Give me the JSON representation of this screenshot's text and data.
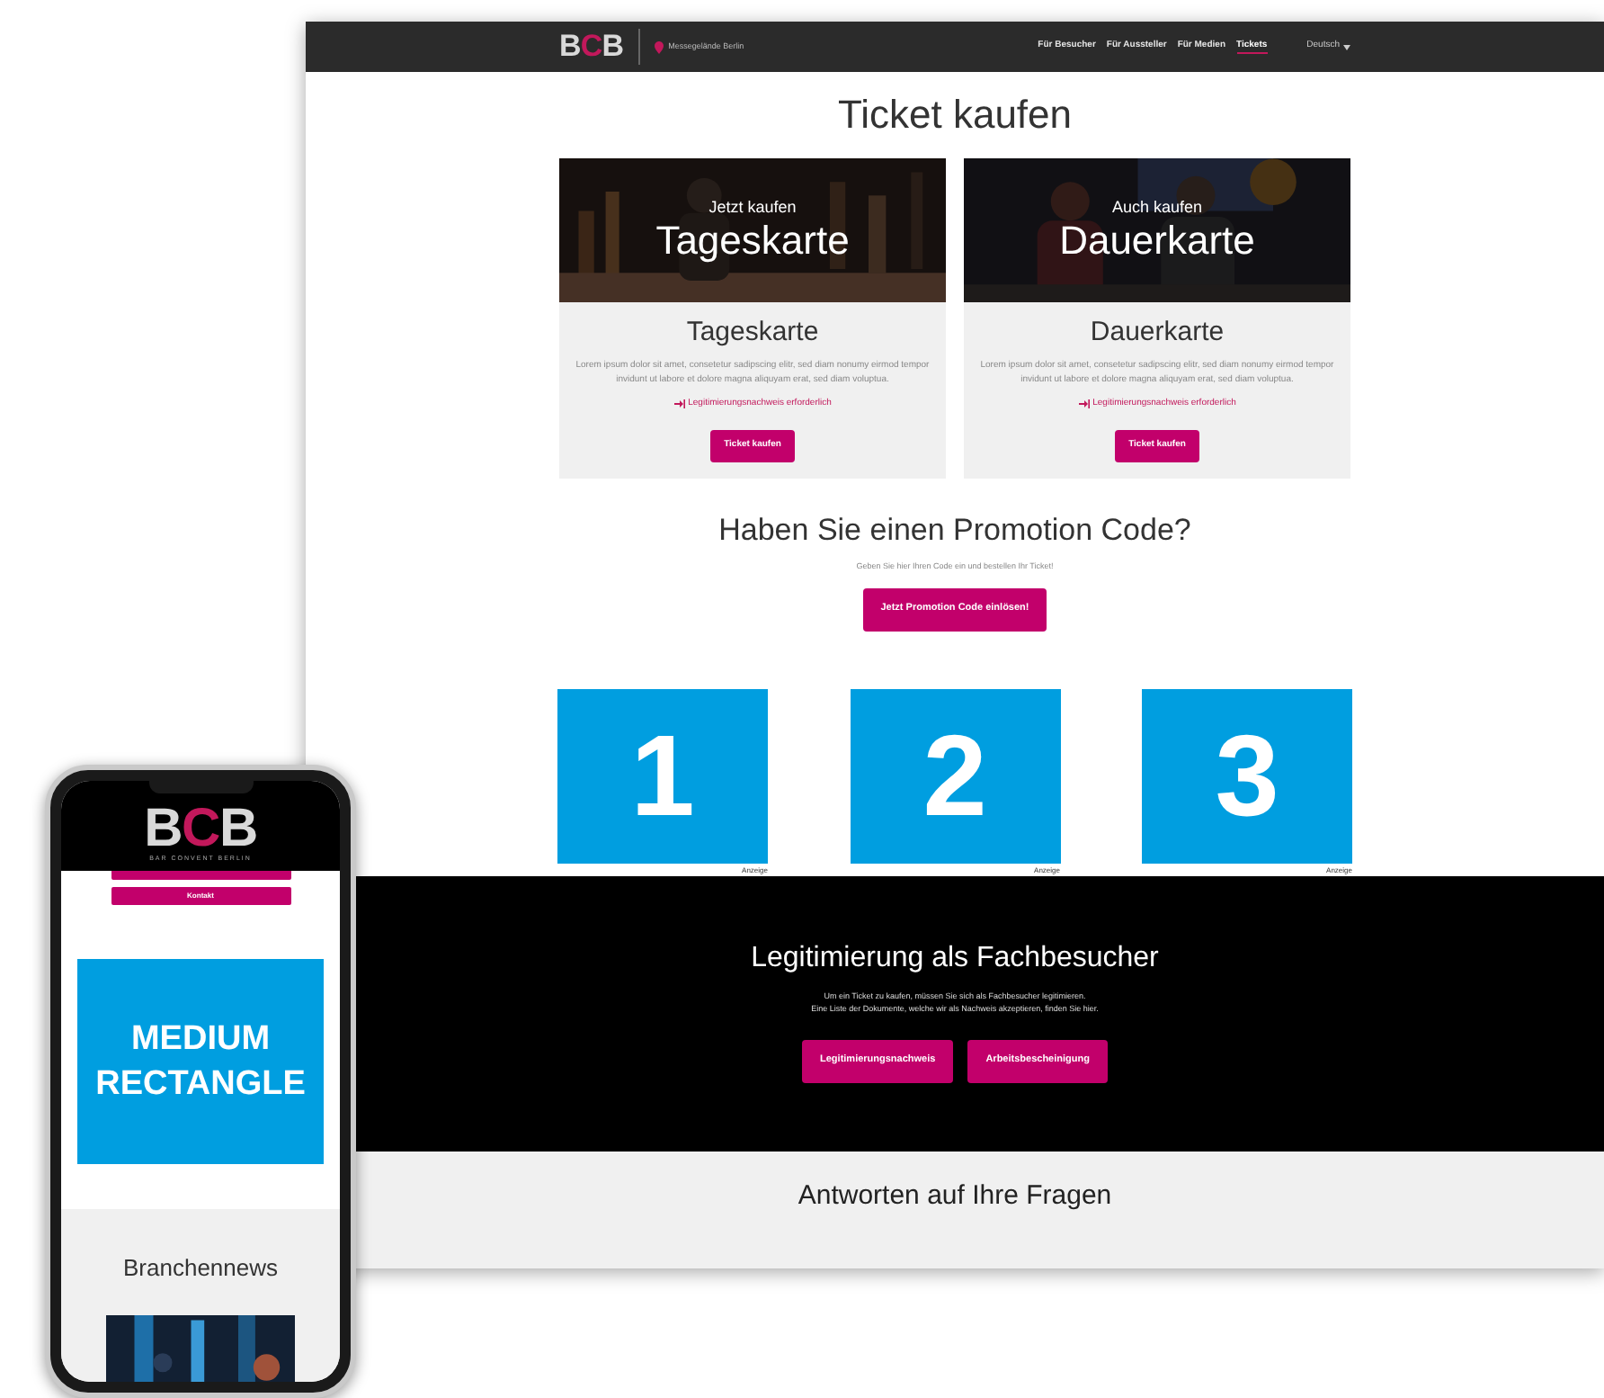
{
  "desktop": {
    "header": {
      "logo_parts": [
        {
          "text": "B",
          "color": "#d9d9d9"
        },
        {
          "text": "C",
          "color": "#c2185b"
        },
        {
          "text": "B",
          "color": "#d9d9d9"
        }
      ],
      "location": "Messegelände Berlin",
      "nav": [
        {
          "label": "Für Besucher",
          "selected": false
        },
        {
          "label": "Für Aussteller",
          "selected": false
        },
        {
          "label": "Für Medien",
          "selected": false
        },
        {
          "label": "Tickets",
          "selected": true
        }
      ],
      "language": "Deutsch"
    },
    "page_title": "Ticket kaufen",
    "ticket_cards": [
      {
        "overline": "Jetzt kaufen",
        "banner_title": "Tageskarte",
        "title": "Tageskarte",
        "description": "Lorem ipsum dolor sit amet, consetetur sadipscing elitr, sed diam nonumy eirmod tempor invidunt ut labore et dolore magna aliquyam erat, sed diam voluptua.",
        "notice": "Legitimierungsnachweis erforderlich",
        "button": "Ticket kaufen"
      },
      {
        "overline": "Auch kaufen",
        "banner_title": "Dauerkarte",
        "title": "Dauerkarte",
        "description": "Lorem ipsum dolor sit amet, consetetur sadipscing elitr, sed diam nonumy eirmod tempor invidunt ut labore et dolore magna aliquyam erat, sed diam voluptua.",
        "notice": "Legitimierungsnachweis erforderlich",
        "button": "Ticket kaufen"
      }
    ],
    "promotion": {
      "heading": "Haben Sie einen Promotion Code?",
      "subtext": "Geben Sie hier Ihren Code ein und bestellen Ihr Ticket!",
      "button": "Jetzt Promotion Code einlösen!"
    },
    "ads": [
      {
        "number": "1",
        "label": "Anzeige"
      },
      {
        "number": "2",
        "label": "Anzeige"
      },
      {
        "number": "3",
        "label": "Anzeige"
      }
    ],
    "legitimation": {
      "heading": "Legitimierung als Fachbesucher",
      "lines": [
        "Um ein Ticket zu kaufen, müssen Sie sich als Fachbesucher legitimieren.",
        "Eine Liste der Dokumente, welche wir als Nachweis akzeptieren, finden Sie hier."
      ],
      "buttons": [
        "Legitimierungsnachweis",
        "Arbeitsbescheinigung"
      ]
    },
    "faq": {
      "heading": "Antworten auf Ihre Fragen"
    }
  },
  "phone": {
    "logo_parts": [
      {
        "text": "B",
        "color": "#d9d9d9"
      },
      {
        "text": "C",
        "color": "#c2185b"
      },
      {
        "text": "B",
        "color": "#d9d9d9"
      }
    ],
    "logo_tagline": "BAR CONVENT BERLIN",
    "menu_button": "Kontakt",
    "ad_text": "MEDIUM RECTANGLE",
    "news_heading": "Branchennews"
  }
}
